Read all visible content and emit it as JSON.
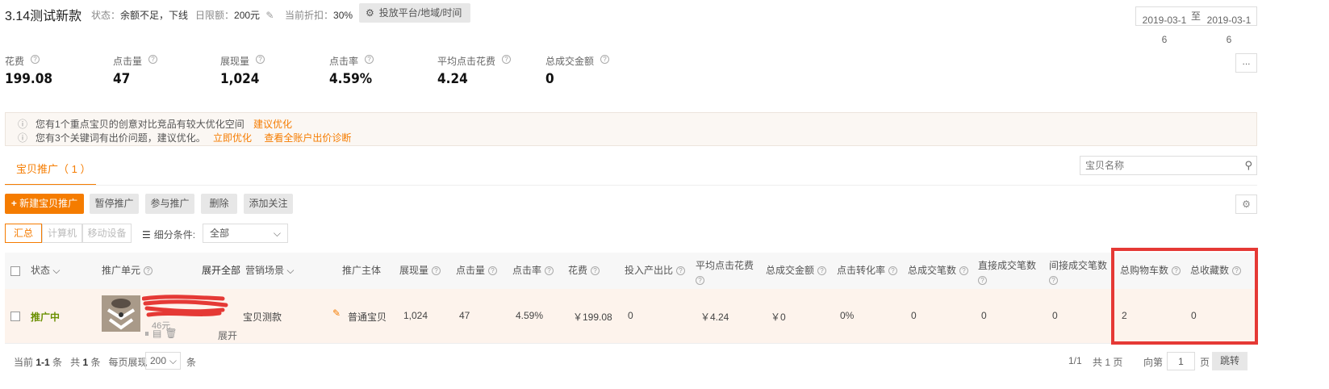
{
  "header": {
    "title": "3.14测试新款",
    "status_label": "状态：",
    "status_value": "余额不足，下线",
    "budget_label": "日限额：",
    "budget_value": "200元",
    "discount_label": "当前折扣：",
    "discount_value": "30%",
    "platform_button": "投放平台/地域/时间",
    "date_start": "2019-03-16",
    "date_sep": "至",
    "date_end": "2019-03-16",
    "more_button": "..."
  },
  "metrics": [
    {
      "label": "花费",
      "value": "199.08"
    },
    {
      "label": "点击量",
      "value": "47"
    },
    {
      "label": "展现量",
      "value": "1,024"
    },
    {
      "label": "点击率",
      "value": "4.59%"
    },
    {
      "label": "平均点击花费",
      "value": "4.24"
    },
    {
      "label": "总成交金额",
      "value": "0"
    }
  ],
  "notices": [
    {
      "text": "您有1个重点宝贝的创意对比竞品有较大优化空间",
      "links": [
        "建议优化"
      ]
    },
    {
      "text": "您有3个关键词有出价问题，建议优化。",
      "links": [
        "立即优化",
        "查看全账户出价诊断"
      ]
    }
  ],
  "tabs": {
    "active": "宝贝推广（ 1 ）",
    "search_placeholder": "宝贝名称"
  },
  "toolbar": {
    "new": "新建宝贝推广",
    "pause": "暂停推广",
    "join": "参与推广",
    "delete": "删除",
    "follow": "添加关注"
  },
  "filters": {
    "summary": "汇总",
    "computer": "计算机",
    "mobile": "移动设备",
    "segment_label": "细分条件:",
    "segment_value": "全部"
  },
  "table": {
    "headers": {
      "status": "状态",
      "unit": "推广单元",
      "expand_all": "展开全部",
      "scene": "营销场景",
      "subject": "推广主体",
      "impressions": "展现量",
      "clicks": "点击量",
      "ctr": "点击率",
      "cost": "花费",
      "roi": "投入产出比",
      "avg_cpc": "平均点击花费",
      "gmv": "总成交金额",
      "cvr": "点击转化率",
      "orders": "总成交笔数",
      "direct_orders": "直接成交笔数",
      "indirect_orders": "间接成交笔数",
      "cart": "总购物车数",
      "fav": "总收藏数"
    },
    "rows": [
      {
        "status": "推广中",
        "price": "46元",
        "expand": "展开",
        "scene": "宝贝测款",
        "subject": "普通宝贝",
        "impressions": "1,024",
        "clicks": "47",
        "ctr": "4.59%",
        "cost": "￥199.08",
        "roi": "0",
        "avg_cpc": "￥4.24",
        "gmv": "￥0",
        "cvr": "0%",
        "orders": "0",
        "direct_orders": "0",
        "indirect_orders": "0",
        "cart": "2",
        "fav": "0"
      }
    ]
  },
  "pagination": {
    "current_prefix": "当前",
    "current_range": "1-1",
    "unit": "条",
    "total_prefix": "共",
    "total": "1",
    "per_page_label": "每页展现",
    "per_page": "200",
    "page_info": "1/1",
    "pages_total": "共 1 页",
    "goto_label": "向第",
    "goto_value": "1",
    "page_suffix": "页",
    "jump_button": "跳转"
  },
  "colors": {
    "accent": "#f57c00",
    "highlight_box": "#e53935",
    "status_green": "#6a8f00",
    "row_bg": "#fdf3ec"
  }
}
